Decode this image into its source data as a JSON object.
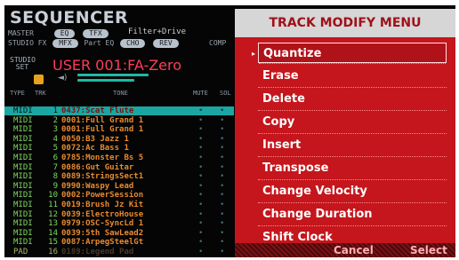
{
  "sequencer": {
    "title": "SEQUENCER",
    "master_label": "MASTER",
    "studio_fx_label": "STUDIO FX",
    "part_eq_label": "Part EQ",
    "pills": {
      "eq": "EQ",
      "tfx": "TFX",
      "mfx": "MFX",
      "cho": "CHO",
      "rev": "REV"
    },
    "status_text": "Filter+Drive",
    "comp_text": "COMP",
    "studio_set_label": "STUDIO SET",
    "studio_set_name": "USER 001:FA-Zero",
    "columns": {
      "type": "TYPE",
      "trk": "TRK",
      "tone": "TONE",
      "mute": "MUTE",
      "solo": "SOL"
    },
    "tracks": [
      {
        "type": "MIDI",
        "num": "1",
        "tone": "0437:Scat Flute"
      },
      {
        "type": "MIDI",
        "num": "2",
        "tone": "0001:Full Grand 1"
      },
      {
        "type": "MIDI",
        "num": "3",
        "tone": "0001:Full Grand 1"
      },
      {
        "type": "MIDI",
        "num": "4",
        "tone": "0050:B3 Jazz 1"
      },
      {
        "type": "MIDI",
        "num": "5",
        "tone": "0072:Ac Bass 1"
      },
      {
        "type": "MIDI",
        "num": "6",
        "tone": "0785:Monster Bs 5"
      },
      {
        "type": "MIDI",
        "num": "7",
        "tone": "0086:Gut Guitar"
      },
      {
        "type": "MIDI",
        "num": "8",
        "tone": "0089:StringsSect1"
      },
      {
        "type": "MIDI",
        "num": "9",
        "tone": "0990:Waspy Lead"
      },
      {
        "type": "MIDI",
        "num": "10",
        "tone": "0002:PowerSession"
      },
      {
        "type": "MIDI",
        "num": "11",
        "tone": "0019:Brush Jz Kit"
      },
      {
        "type": "MIDI",
        "num": "12",
        "tone": "0039:ElectroHouse"
      },
      {
        "type": "MIDI",
        "num": "13",
        "tone": "0979:OSC-SyncLd 1"
      },
      {
        "type": "MIDI",
        "num": "14",
        "tone": "0039:5th SawLead2"
      },
      {
        "type": "MIDI",
        "num": "15",
        "tone": "0087:ArpegSteelGt"
      },
      {
        "type": "PAD",
        "num": "16",
        "tone": "0189:Legend Pad"
      }
    ],
    "mute_mark": "•",
    "solo_mark": "•"
  },
  "menu": {
    "title": "TRACK MODIFY MENU",
    "items": [
      "Quantize",
      "Erase",
      "Delete",
      "Copy",
      "Insert",
      "Transpose",
      "Change Velocity",
      "Change Duration",
      "Shift Clock"
    ],
    "selected": "Quantize",
    "cancel_label": "Cancel",
    "select_label": "Select"
  },
  "colors": {
    "menu_red": "#c4161c",
    "accent_teal": "#1aa7a3",
    "tone_orange": "#e88a2e",
    "midi_green": "#7fd85e",
    "studio_pink": "#ff3c5a"
  }
}
